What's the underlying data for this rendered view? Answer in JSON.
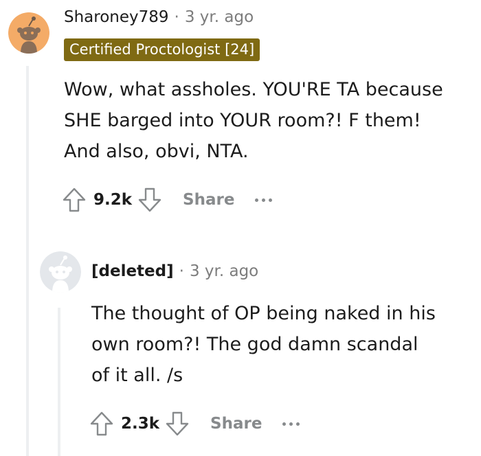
{
  "comments": [
    {
      "username": "Sharoney789",
      "separator": "·",
      "time": "3 yr. ago",
      "flair": "Certified Proctologist [24]",
      "body_lines": [
        "Wow, what assholes. YOU'RE TA because",
        "SHE barged into YOUR room?! F them!",
        "And also, obvi, NTA."
      ],
      "score": "9.2k",
      "share_label": "Share",
      "avatar_color": "#f0a657"
    },
    {
      "username": "[deleted]",
      "separator": "·",
      "time": "3 yr. ago",
      "body_lines": [
        "The thought of OP being naked in his",
        "own room?! The god damn scandal",
        "of it all. /s"
      ],
      "score": "2.3k",
      "share_label": "Share",
      "avatar_color": "#dfe3e8"
    }
  ],
  "colors": {
    "flair_bg": "#7f6a13",
    "meta_gray": "#7c7c7c",
    "action_gray": "#878a8c",
    "thread_line": "#edeff1"
  }
}
